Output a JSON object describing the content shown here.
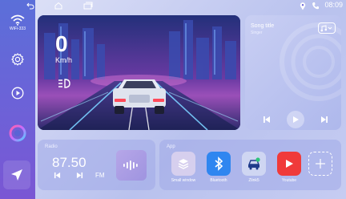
{
  "status_bar": {
    "time": "08:09",
    "icons": [
      "back-icon",
      "home-icon",
      "recent-apps-icon",
      "location-icon",
      "phone-icon"
    ]
  },
  "sidebar": {
    "wifi_label": "WiFi-333",
    "items": [
      "wifi-icon",
      "settings-icon",
      "play-icon",
      "assistant-icon",
      "navigation-icon"
    ]
  },
  "dashboard": {
    "speed": "0",
    "speed_unit": "Km/h",
    "headlight_icon": "headlight-icon"
  },
  "music": {
    "song_title": "Song title",
    "singer": "Singer",
    "controls": [
      "previous-icon",
      "play-icon",
      "next-icon"
    ],
    "mode_icon": "playlist-icon"
  },
  "radio": {
    "label": "Radio",
    "frequency": "87.50",
    "band": "FM"
  },
  "apps": {
    "label": "App",
    "items": [
      {
        "name": "Small window",
        "icon": "layers-icon",
        "color": "#d6cfee"
      },
      {
        "name": "Bluetooth",
        "icon": "bluetooth-icon",
        "color": "#2f86f0"
      },
      {
        "name": "Zlink5",
        "icon": "zlink-car-icon",
        "color": "#cfd6f2"
      },
      {
        "name": "Youtube",
        "icon": "youtube-icon",
        "color": "#f03a3a"
      }
    ]
  },
  "colors": {
    "accent": "#6a64d8",
    "card": "#a0aae8",
    "road_glow": "#7ad0ff"
  }
}
